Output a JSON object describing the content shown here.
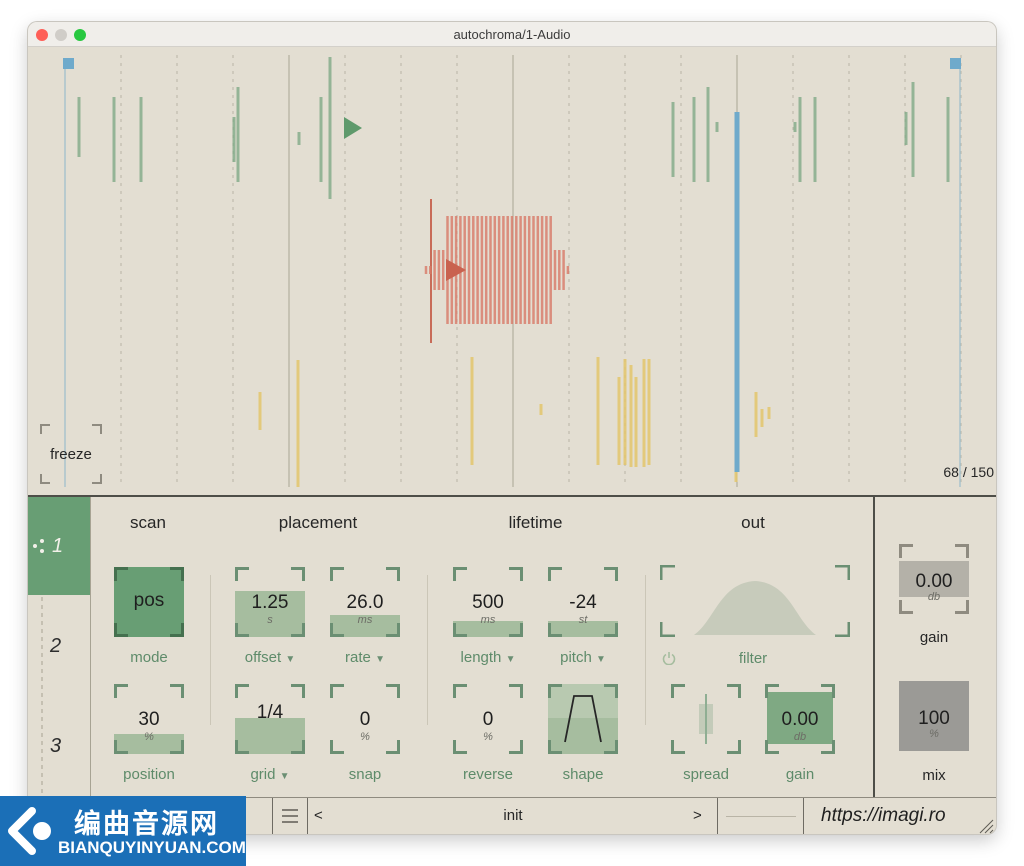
{
  "window": {
    "title": "autochroma/1-Audio",
    "traffic_lights": {
      "close": "#fe5f57",
      "minimize": "#febc2e",
      "zoom": "#28c840"
    }
  },
  "visualizer": {
    "freeze_label": "freeze",
    "counter_current": "68",
    "counter_separator": "/",
    "counter_total": "150",
    "colors": {
      "green": "#7aa682",
      "red": "#d97a68",
      "yellow": "#e3c66d",
      "blue": "#6faacb",
      "grid": "#b9b4a6"
    }
  },
  "tabs": [
    {
      "label": "1",
      "icon": "grains-icon",
      "active": true
    },
    {
      "label": "2",
      "active": false
    },
    {
      "label": "3",
      "active": false
    }
  ],
  "sections": {
    "scan": "scan",
    "placement": "placement",
    "lifetime": "lifetime",
    "out": "out"
  },
  "controls": {
    "mode": {
      "value": "pos",
      "label": "mode"
    },
    "position": {
      "value": "30",
      "unit": "%",
      "label": "position",
      "level": 0.3
    },
    "offset": {
      "value": "1.25",
      "unit": "s",
      "label": "offset",
      "level": 0.6
    },
    "rate": {
      "value": "26.0",
      "unit": "ms",
      "label": "rate",
      "level": 0.3
    },
    "grid": {
      "value": "1/4",
      "label": "grid",
      "level": 0.5
    },
    "snap": {
      "value": "0",
      "unit": "%",
      "label": "snap",
      "level": 0
    },
    "length": {
      "value": "500",
      "unit": "ms",
      "label": "length",
      "level": 0.2
    },
    "pitch": {
      "value": "-24",
      "unit": "st",
      "label": "pitch",
      "level": 0.2
    },
    "reverse": {
      "value": "0",
      "unit": "%",
      "label": "reverse",
      "level": 0
    },
    "shape": {
      "label": "shape"
    },
    "filter": {
      "label": "filter"
    },
    "spread": {
      "label": "spread"
    },
    "gain": {
      "value": "0.00",
      "unit": "db",
      "label": "gain"
    },
    "master_gain": {
      "value": "0.00",
      "unit": "db",
      "label": "gain"
    },
    "mix": {
      "value": "100",
      "unit": "%",
      "label": "mix"
    }
  },
  "bottombar": {
    "menu_icon": "hamburger-icon",
    "prev": "<",
    "preset": "init",
    "next": ">",
    "url": "https://imagi.ro"
  },
  "watermark": {
    "brand": "编曲音源网",
    "site": "BIANQUYINYUAN.COM"
  }
}
